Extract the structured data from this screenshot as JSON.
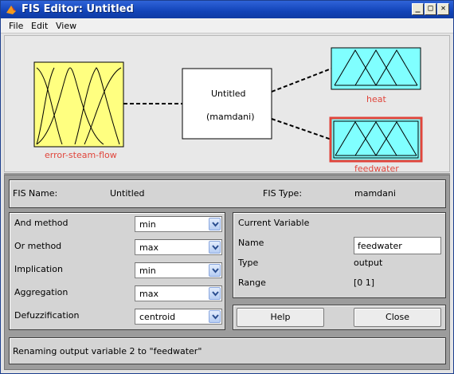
{
  "window": {
    "title": "FIS Editor: Untitled",
    "controls": {
      "minimize": "_",
      "maximize": "□",
      "close": "✕"
    }
  },
  "menu": {
    "items": [
      "File",
      "Edit",
      "View"
    ]
  },
  "diagram": {
    "input_label": "error-steam-flow",
    "system_name": "Untitled",
    "system_type": "(mamdani)",
    "output1_label": "heat",
    "output2_label": "feedwater",
    "colors": {
      "input": "#ffff80",
      "output": "#80ffff",
      "selected_border": "#e0453b",
      "label": "#e0453b"
    }
  },
  "fis_info": {
    "name_label": "FIS Name:",
    "name_value": "Untitled",
    "type_label": "FIS Type:",
    "type_value": "mamdani"
  },
  "methods": {
    "and": {
      "label": "And method",
      "value": "min"
    },
    "or": {
      "label": "Or method",
      "value": "max"
    },
    "implication": {
      "label": "Implication",
      "value": "min"
    },
    "aggregation": {
      "label": "Aggregation",
      "value": "max"
    },
    "defuzz": {
      "label": "Defuzzification",
      "value": "centroid"
    }
  },
  "current_variable": {
    "heading": "Current Variable",
    "name_label": "Name",
    "name_value": "feedwater",
    "type_label": "Type",
    "type_value": "output",
    "range_label": "Range",
    "range_value": "[0 1]"
  },
  "buttons": {
    "help": "Help",
    "close": "Close"
  },
  "status": {
    "message": "Renaming output variable 2 to \"feedwater\""
  }
}
